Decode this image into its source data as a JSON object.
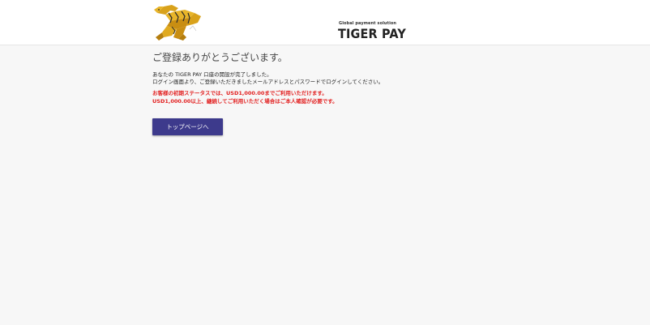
{
  "header": {
    "logo": {
      "tagline": "Global payment solution",
      "wordmark": "TIGER PAY",
      "icon": "tiger-logo-icon",
      "colors": {
        "gold": "#d9a21b",
        "dark": "#2a2a2a"
      }
    }
  },
  "main": {
    "title": "ご登録ありがとうございます。",
    "description": [
      "あなたの TIGER PAY 口座の開設が完了しました。",
      "ログイン画面より、ご登録いただきましたメールアドレスとパスワードでログインしてください。"
    ],
    "notice": [
      "お客様の初期ステータスでは、USD1,000.00までご利用いただけます。",
      "USD1,000.00以上、継続してご利用いただく場合はご本人確認が必要です。"
    ],
    "notice_color": "#e21f1f",
    "button_label": "トップページへ",
    "button_color": "#3d3a8c"
  }
}
